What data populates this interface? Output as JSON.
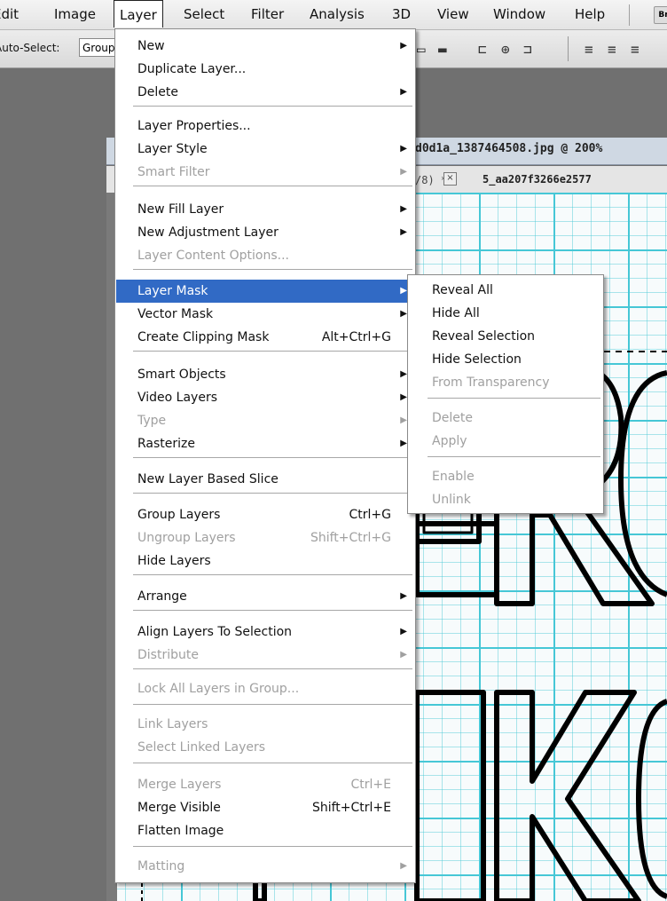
{
  "menubar": {
    "items": [
      "Edit",
      "Image",
      "Layer",
      "Select",
      "Filter",
      "Analysis",
      "3D",
      "View",
      "Window",
      "Help"
    ],
    "active": "Layer",
    "bridge_label": "Br"
  },
  "options_bar": {
    "auto_select_label": "Auto-Select:",
    "auto_select_value": "Group"
  },
  "document": {
    "title": "d0d1a_1387464508.jpg @ 200%",
    "tab_fragment": "/8) *",
    "close_glyph": "×",
    "tab2_label": "5_aa207f3266e2577"
  },
  "layer_menu": {
    "items": [
      {
        "label": "New",
        "arrow": true
      },
      {
        "label": "Duplicate Layer..."
      },
      {
        "label": "Delete",
        "arrow": true
      },
      {
        "sep": true
      },
      {
        "label": "Layer Properties..."
      },
      {
        "label": "Layer Style",
        "arrow": true
      },
      {
        "label": "Smart Filter",
        "arrow": true,
        "disabled": true
      },
      {
        "sep": true
      },
      {
        "label": "New Fill Layer",
        "arrow": true
      },
      {
        "label": "New Adjustment Layer",
        "arrow": true
      },
      {
        "label": "Layer Content Options...",
        "disabled": true
      },
      {
        "sep": true
      },
      {
        "label": "Layer Mask",
        "arrow": true,
        "highlighted": true
      },
      {
        "label": "Vector Mask",
        "arrow": true
      },
      {
        "label": "Create Clipping Mask",
        "shortcut": "Alt+Ctrl+G"
      },
      {
        "sep": true
      },
      {
        "label": "Smart Objects",
        "arrow": true
      },
      {
        "label": "Video Layers",
        "arrow": true
      },
      {
        "label": "Type",
        "arrow": true,
        "disabled": true
      },
      {
        "label": "Rasterize",
        "arrow": true
      },
      {
        "sep": true
      },
      {
        "label": "New Layer Based Slice"
      },
      {
        "sep": true
      },
      {
        "label": "Group Layers",
        "shortcut": "Ctrl+G"
      },
      {
        "label": "Ungroup Layers",
        "shortcut": "Shift+Ctrl+G",
        "disabled": true
      },
      {
        "label": "Hide Layers"
      },
      {
        "sep": true
      },
      {
        "label": "Arrange",
        "arrow": true
      },
      {
        "sep": true
      },
      {
        "label": "Align Layers To Selection",
        "arrow": true
      },
      {
        "label": "Distribute",
        "arrow": true,
        "disabled": true
      },
      {
        "sep": true
      },
      {
        "label": "Lock All Layers in Group...",
        "disabled": true
      },
      {
        "sep": true
      },
      {
        "label": "Link Layers",
        "disabled": true
      },
      {
        "label": "Select Linked Layers",
        "disabled": true
      },
      {
        "sep": true
      },
      {
        "label": "Merge Layers",
        "shortcut": "Ctrl+E",
        "disabled": true
      },
      {
        "label": "Merge Visible",
        "shortcut": "Shift+Ctrl+E"
      },
      {
        "label": "Flatten Image"
      },
      {
        "sep": true
      },
      {
        "label": "Matting",
        "arrow": true,
        "disabled": true
      }
    ]
  },
  "layer_mask_submenu": {
    "items": [
      {
        "label": "Reveal All"
      },
      {
        "label": "Hide All"
      },
      {
        "label": "Reveal Selection"
      },
      {
        "label": "Hide Selection"
      },
      {
        "label": "From Transparency",
        "disabled": true
      },
      {
        "sep": true
      },
      {
        "label": "Delete",
        "disabled": true
      },
      {
        "label": "Apply",
        "disabled": true
      },
      {
        "sep": true
      },
      {
        "label": "Enable",
        "disabled": true
      },
      {
        "label": "Unlink",
        "disabled": true
      }
    ]
  },
  "colors": {
    "highlight": "#316ac5",
    "disabled_text": "#a0a0a0",
    "grid": "#46c7d6"
  }
}
